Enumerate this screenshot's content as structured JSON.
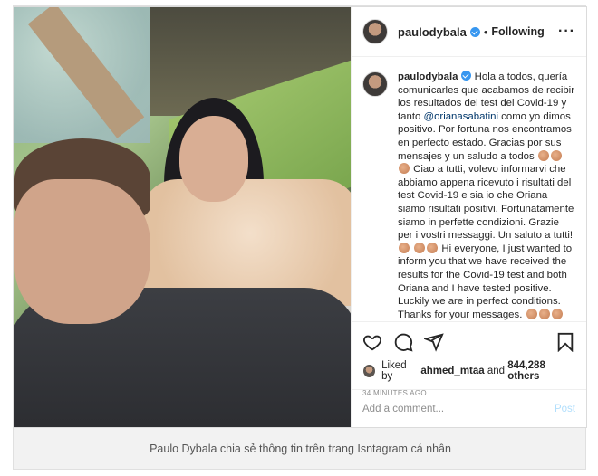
{
  "post": {
    "username": "paulodybala",
    "follow_status": "Following",
    "separator": "•",
    "more_icon": "more-horizontal-icon",
    "caption": {
      "username": "paulodybala",
      "part1": "Hola a todos, quería comunicarles que acabamos de recibir los resultados del test del Covid-19 y tanto ",
      "mention": "@orianasabatini",
      "part2": " como yo dimos positivo. Por fortuna nos encontramos en perfecto estado. Gracias por sus mensajes y un saludo a todos",
      "part3": "Ciao a tutti, volevo informarvi che abbiamo appena ricevuto i risultati del test Covid-19 e sia io che Oriana siamo risultati positivi. Fortunatamente siamo in perfette condizioni. Grazie per i vostri messaggi. Un saluto a tutti!",
      "part4": "Hi everyone, I just wanted to inform you that we have received the results for the Covid-19 test and both Oriana and I have tested positive. Luckily we are in perfect conditions. Thanks for your messages."
    },
    "actions": {
      "like_icon": "heart-icon",
      "comment_icon": "comment-icon",
      "share_icon": "send-icon",
      "save_icon": "bookmark-icon"
    },
    "likes": {
      "prefix": "Liked by",
      "user": "ahmed_mtaa",
      "and": "and",
      "count": "844,288 others"
    },
    "time_ago": "34 MINUTES AGO",
    "comment": {
      "placeholder": "Add a comment...",
      "post_label": "Post"
    }
  },
  "figure_caption": "Paulo Dybala chia sẻ thông tin trên trang Isntagram cá nhân",
  "colors": {
    "verified": "#3897f0",
    "mention": "#00376b",
    "post_button": "#b2dffc",
    "muted": "#8e8e8e"
  }
}
